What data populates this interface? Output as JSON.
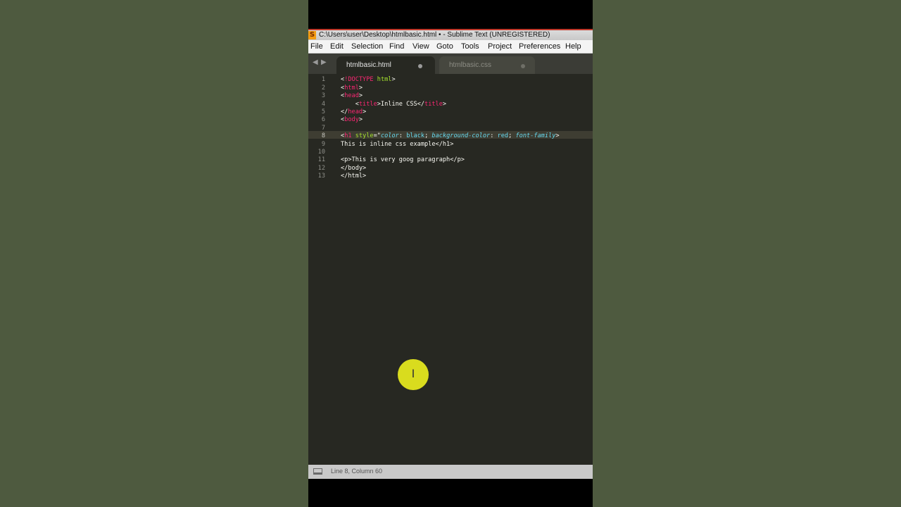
{
  "window": {
    "title": "C:\\Users\\user\\Desktop\\htmlbasic.html • - Sublime Text (UNREGISTERED)",
    "app_icon_letter": "S"
  },
  "menu": [
    "File",
    "Edit",
    "Selection",
    "Find",
    "View",
    "Goto",
    "Tools",
    "Project",
    "Preferences",
    "Help"
  ],
  "tabs": [
    {
      "label": "htmlbasic.html",
      "active": true
    },
    {
      "label": "htmlbasic.css",
      "active": false
    }
  ],
  "line_numbers": [
    "1",
    "2",
    "3",
    "4",
    "5",
    "6",
    "7",
    "8",
    "9",
    "10",
    "11",
    "12",
    "13"
  ],
  "code": {
    "l1": {
      "a": "<",
      "b": "!DOCTYPE",
      "c": " html",
      "d": ">"
    },
    "l2": {
      "a": "<",
      "b": "html",
      "c": ">"
    },
    "l3": {
      "a": "<",
      "b": "head",
      "c": ">"
    },
    "l4": {
      "a": "    <",
      "b": "title",
      "c": ">Inline CSS</",
      "d": "title",
      "e": ">"
    },
    "l5": {
      "a": "</",
      "b": "head",
      "c": ">"
    },
    "l6": {
      "a": "<",
      "b": "body",
      "c": ">"
    },
    "l8": {
      "a": "<",
      "b": "h1",
      "c": " style",
      "d": "=\"",
      "e": "color",
      "f": ": ",
      "g": "black",
      "h": "; ",
      "i": "background-color",
      "j": ": ",
      "k": "red",
      "l": "; ",
      "m": "font-family",
      "n": ">"
    },
    "l9": "This is inline css example</h1>",
    "l11": "<p>This is very goog paragraph</p>",
    "l12": "</body>",
    "l13": "</html>"
  },
  "status": {
    "position": "Line 8, Column 60"
  },
  "cursor_glyph": "I",
  "colors": {
    "tag": "#f92672",
    "attr": "#a6e22e",
    "string": "#e6db74",
    "keyword": "#66d9ef",
    "editor_bg": "#272822"
  }
}
